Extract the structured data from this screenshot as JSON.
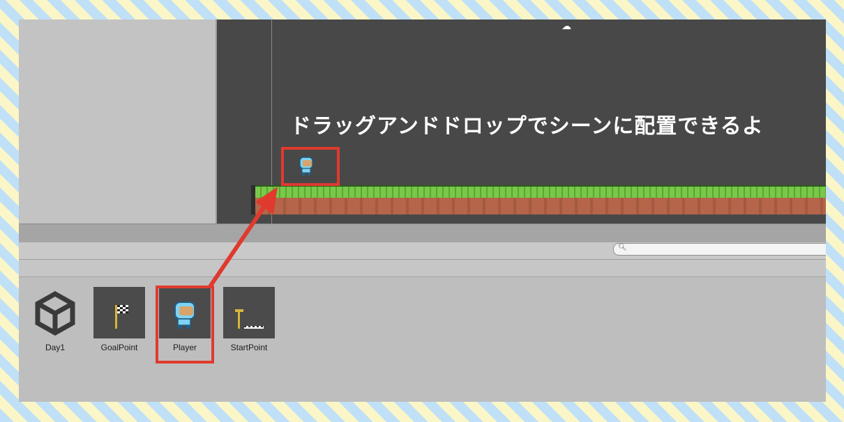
{
  "scene": {
    "caption": "ドラッグアンドドロップでシーンに配置できるよ",
    "gizmo_icon": "scene-gizmo-icon"
  },
  "project": {
    "search": {
      "placeholder": "",
      "icon": "search-icon"
    },
    "assets": [
      {
        "label": "Day1",
        "icon": "unity-logo-icon"
      },
      {
        "label": "GoalPoint",
        "icon": "checkered-flag-icon"
      },
      {
        "label": "Player",
        "icon": "player-character-icon"
      },
      {
        "label": "StartPoint",
        "icon": "start-flag-icon"
      }
    ]
  },
  "annotation": {
    "highlight_color": "#e03a2e",
    "arrow": "drag-arrow-icon"
  },
  "colors": {
    "scene_background": "#484848",
    "panel_background": "#bdbdbd",
    "grass": "#79c84a",
    "dirt": "#b4654a"
  }
}
